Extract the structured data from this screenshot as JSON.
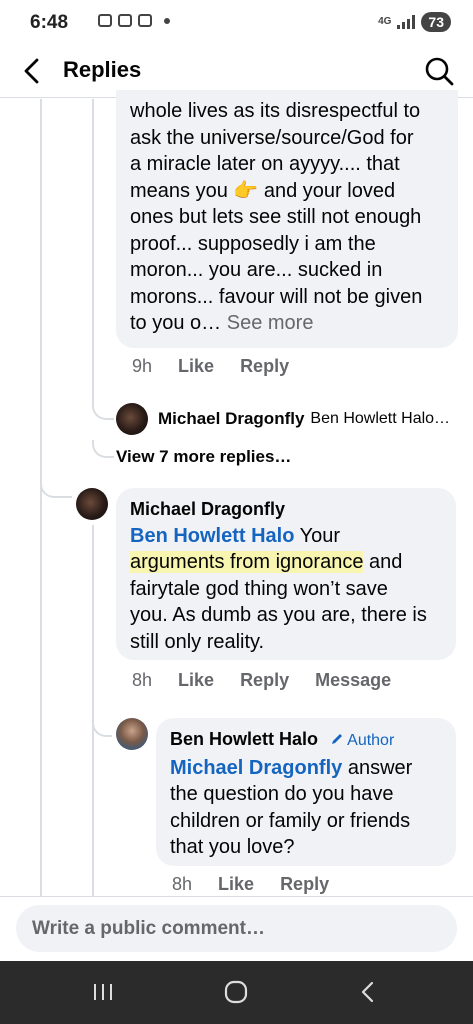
{
  "status_bar": {
    "time": "6:48",
    "network": "4G",
    "battery": "73"
  },
  "header": {
    "title": "Replies",
    "back_icon": "back-arrow-icon",
    "search_icon": "search-icon"
  },
  "comments": [
    {
      "text_lines": [
        "whole lives as its disrespectful to",
        "ask the universe/source/God for",
        "a miracle later on ayyyy.... that",
        "means you",
        "and your loved",
        "ones but lets see still not enough",
        "proof... supposedly i am the",
        "moron... you are... sucked in",
        "morons... favour will not be given",
        "to you o…"
      ],
      "emoji": "👉",
      "see_more": "See more",
      "time": "9h",
      "like": "Like",
      "reply": "Reply"
    },
    {
      "author": "Michael Dragonfly",
      "mention": "Ben Howlett Halo",
      "text_1": "Your",
      "highlight": "arguments from ignorance",
      "text_2": "and",
      "text_3": "fairytale god thing won’t save",
      "text_4": "you. As dumb as you are, there is",
      "text_5": "still only reality.",
      "time": "8h",
      "like": "Like",
      "reply": "Reply",
      "message": "Message"
    },
    {
      "author": "Ben Howlett Halo",
      "badge": "Author",
      "mention": "Michael Dragonfly",
      "text_1": "answer",
      "text_2": "the question do you have",
      "text_3": "children or family or friends",
      "text_4": "that you love?",
      "time": "8h",
      "like": "Like",
      "reply": "Reply"
    }
  ],
  "reply_preview": {
    "name": "Michael Dragonfly",
    "text": "Ben Howlett Halo…"
  },
  "view_more": "View 7 more replies…",
  "composer": {
    "placeholder": "Write a public comment…"
  }
}
